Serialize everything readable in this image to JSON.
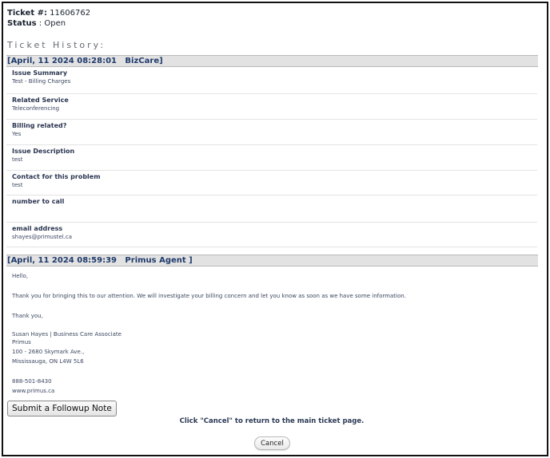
{
  "ticket": {
    "number_label": "Ticket #:",
    "number": "11606762",
    "status_label": "Status",
    "status_sep": ":",
    "status": "Open"
  },
  "history_title": "Ticket History:",
  "entries": [
    {
      "header": "[April, 11 2024 08:28:01   BizCare]",
      "fields": [
        {
          "label": "Issue Summary",
          "value": "Test - Billing Charges"
        },
        {
          "label": "Related Service",
          "value": "Teleconferencing"
        },
        {
          "label": "Billing related?",
          "value": "Yes"
        },
        {
          "label": "Issue Description",
          "value": "test"
        },
        {
          "label": "Contact for this problem",
          "value": "test"
        },
        {
          "label": "number to call",
          "value": ""
        },
        {
          "label": "email address",
          "value": "shayes@primustel.ca"
        }
      ]
    },
    {
      "header": "[April, 11 2024 08:59:39   Primus Agent ]",
      "message": {
        "greeting": "Hello,",
        "body": "Thank you for bringing this to our attention. We will investigate your billing concern and let you know as soon as we have some information.",
        "closing": "Thank you,",
        "signature": [
          "Susan Hayes | Business Care Associate",
          "Primus",
          "100 - 2680 Skymark Ave.,",
          "Mississauga, ON L4W 5L6"
        ],
        "contact": [
          "888-501-8430",
          "www.primus.ca"
        ]
      }
    }
  ],
  "actions": {
    "followup_label": "Submit a Followup Note",
    "hint": "Click \"Cancel\" to return to the main ticket page.",
    "cancel_label": "Cancel"
  }
}
